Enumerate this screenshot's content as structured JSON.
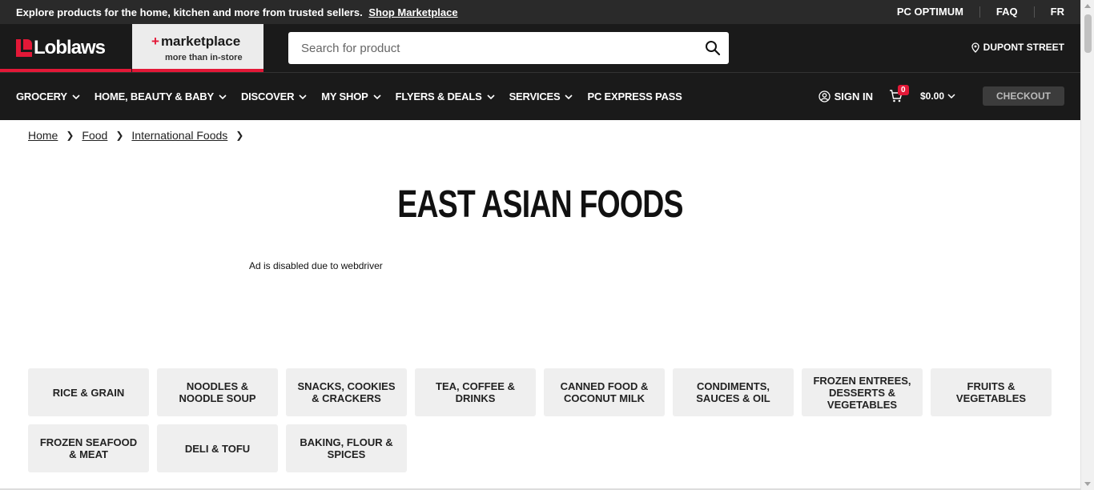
{
  "promo": {
    "message": "Explore products for the home, kitchen and more from trusted sellers.",
    "link": "Shop Marketplace",
    "links": [
      "PC OPTIMUM",
      "FAQ",
      "FR"
    ]
  },
  "header": {
    "brand": "Loblaws",
    "marketplace_title": "marketplace",
    "marketplace_sub": "more than in-store",
    "search_placeholder": "Search for product",
    "store": "DUPONT STREET"
  },
  "nav": {
    "items": [
      {
        "label": "GROCERY",
        "dropdown": true
      },
      {
        "label": "HOME, BEAUTY & BABY",
        "dropdown": true
      },
      {
        "label": "DISCOVER",
        "dropdown": true
      },
      {
        "label": "MY SHOP",
        "dropdown": true
      },
      {
        "label": "FLYERS & DEALS",
        "dropdown": true
      },
      {
        "label": "SERVICES",
        "dropdown": true
      },
      {
        "label": "PC EXPRESS PASS",
        "dropdown": false
      }
    ],
    "sign_in": "SIGN IN",
    "cart_count": "0",
    "cart_total": "$0.00",
    "checkout": "CHECKOUT"
  },
  "breadcrumb": [
    "Home",
    "Food",
    "International Foods"
  ],
  "page_title": "EAST ASIAN FOODS",
  "ad_text": "Ad is disabled due to webdriver",
  "categories": [
    "RICE & GRAIN",
    "NOODLES & NOODLE SOUP",
    "SNACKS, COOKIES & CRACKERS",
    "TEA, COFFEE & DRINKS",
    "CANNED FOOD & COCONUT MILK",
    "CONDIMENTS, SAUCES & OIL",
    "FROZEN ENTREES, DESSERTS & VEGETABLES",
    "FRUITS & VEGETABLES",
    "FROZEN SEAFOOD & MEAT",
    "DELI & TOFU",
    "BAKING, FLOUR & SPICES"
  ],
  "colors": {
    "brand_red": "#e31837",
    "header_bg": "#1a1a1a",
    "tile_bg": "#efefef"
  }
}
